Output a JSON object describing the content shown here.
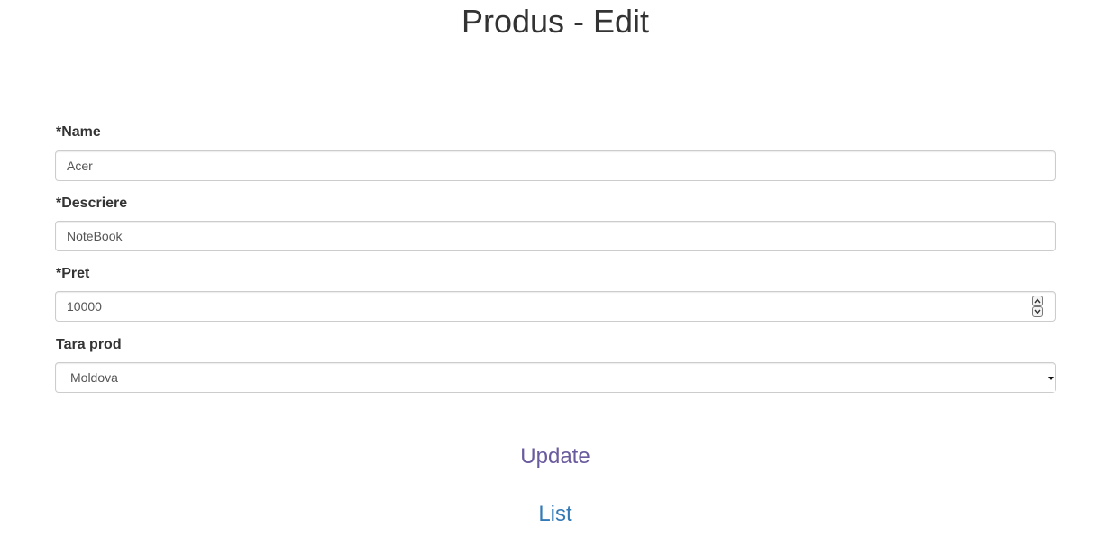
{
  "page": {
    "title": "Produs - Edit"
  },
  "form": {
    "name": {
      "label": "*Name",
      "value": "Acer"
    },
    "descriere": {
      "label": "*Descriere",
      "value": "NoteBook"
    },
    "pret": {
      "label": "*Pret",
      "value": "10000"
    },
    "tara": {
      "label": "Tara prod",
      "selected": "Moldova"
    }
  },
  "actions": {
    "update_label": "Update",
    "list_label": "List"
  },
  "colors": {
    "visited_link": "#6a5a9e",
    "link": "#337ab7",
    "input_border": "#cccccc"
  },
  "icons": {
    "spinner_up": "chevron-up-icon",
    "spinner_down": "chevron-down-icon",
    "select_arrow": "caret-down-icon"
  }
}
